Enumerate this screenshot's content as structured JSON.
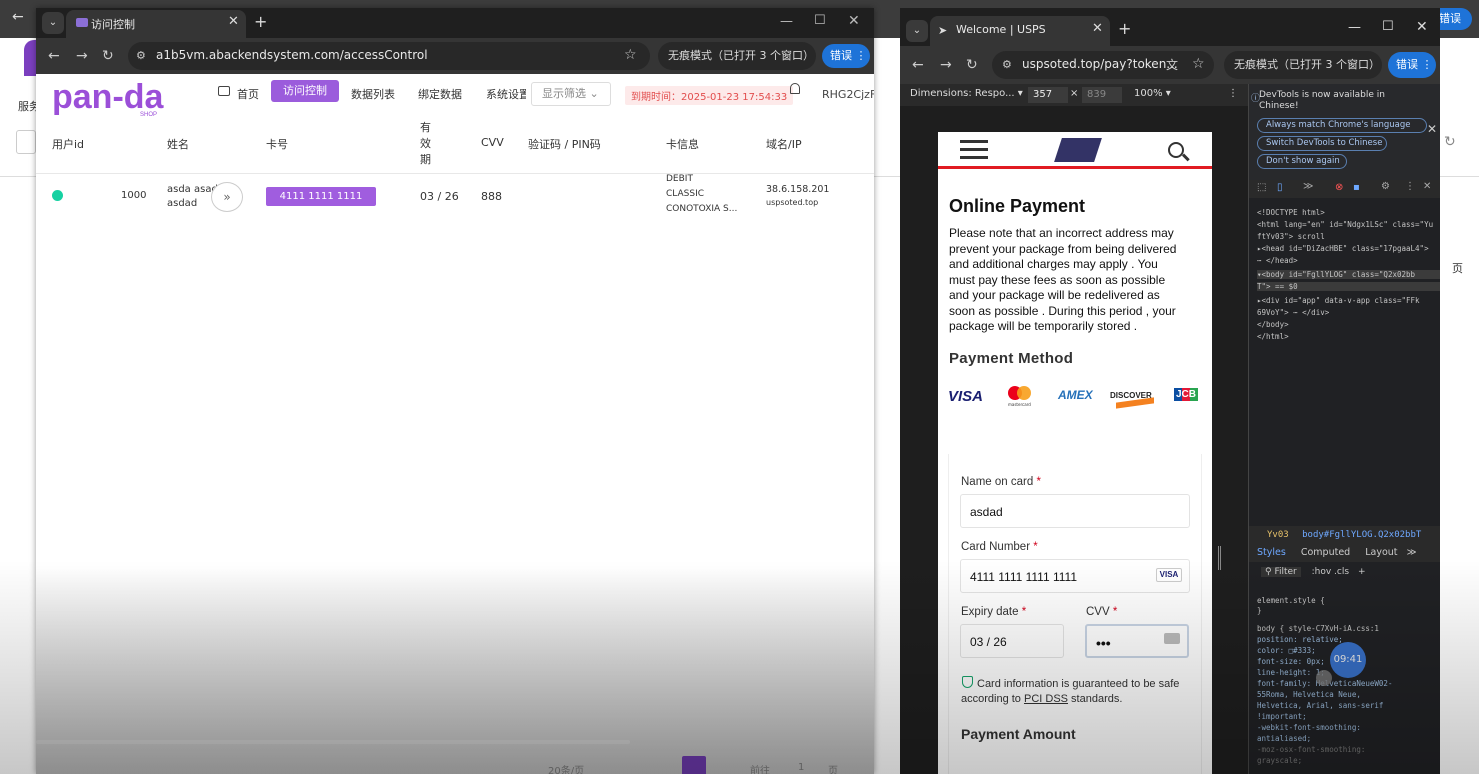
{
  "left_window": {
    "tab_title": "访问控制",
    "url": "a1b5vm.abackendsystem.com/accessControl",
    "incognito": "无痕模式（已打开 3 个窗口）",
    "error_badge": "错误",
    "logo_text": "pan-da",
    "logo_sub": "SHOP",
    "nav": [
      "首页",
      "访问控制",
      "数据列表",
      "绑定数据",
      "系统设置"
    ],
    "filter_label": "显示筛选",
    "expire_label": "到期时间：",
    "expire_value": "2025-01-23 17:54:33",
    "username": "RHG2CjzF",
    "columns": [
      "用户id",
      "姓名",
      "卡号",
      "有效期",
      "CVV",
      "验证码 / PIN码",
      "卡信息",
      "域名/IP"
    ],
    "row": {
      "user_id": "1000",
      "name_line1": "asda asad",
      "name_line2": "asdad",
      "card_number": "4111 1111 1111 1111",
      "expiry": "03 / 26",
      "cvv": "888",
      "card_info_1": "DEBIT",
      "card_info_2": "CLASSIC",
      "card_info_3": "CONOTOXIA S...",
      "ip": "38.6.158.201",
      "domain": "uspsoted.top"
    },
    "pagination": {
      "per_page": "20条/页",
      "goto": "前往",
      "page": "1",
      "unit": "页"
    }
  },
  "right_window": {
    "tab_title": "Welcome | USPS",
    "url": "uspsoted.top/pay?token...",
    "incognito": "无痕模式（已打开 3 个窗口）",
    "error_badge": "错误",
    "device": {
      "label": "Dimensions: Respo...",
      "width": "357",
      "height": "839",
      "zoom": "100%"
    },
    "page": {
      "title": "Online Payment",
      "notice": "Please note that an incorrect address may prevent your package from being delivered and additional charges may apply . You must pay these fees as soon as possible and your package will be redelivered as soon as possible . During this period , your package will be temporarily stored .",
      "payment_method": "Payment Method",
      "brands": [
        "VISA",
        "mastercard",
        "AMEX",
        "DISCOVER",
        "JCB"
      ],
      "name_label": "Name on card",
      "name_value": "asdad",
      "card_label": "Card Number",
      "card_value": "4111 1111 1111 1111",
      "card_brand": "VISA",
      "expiry_label": "Expiry date",
      "expiry_value": "03 / 26",
      "cvv_label": "CVV",
      "cvv_value": "•••",
      "required": "*",
      "secure_pre": "Card information is guaranteed to be safe according to ",
      "secure_link": "PCI DSS",
      "secure_post": " standards.",
      "amount": "Payment Amount"
    },
    "devtools": {
      "info": "DevTools is now available in Chinese!",
      "btn1": "Always match Chrome's language",
      "btn2": "Switch DevTools to Chinese",
      "btn3": "Don't show again",
      "code": [
        "<!DOCTYPE html>",
        "<html lang=\"en\" id=\"Ndgx1LSc\" class=\"Yu",
        "ftYv03\"> scroll",
        "▸<head id=\"DiZacHBE\" class=\"17pgaaL4\">",
        "  ⋯ </head>",
        "▾<body id=\"FgllYLOG\" class=\"Q2x02bb",
        "  T\"> == $0",
        "  ▸<div id=\"app\" data-v-app class=\"FFk",
        "   69VoY\"> ⋯ </div>",
        "  </body>",
        "</html>"
      ],
      "crumb_a": "Yv03",
      "crumb_b": "body#FgllYLOG.Q2x02bbT",
      "tabs": [
        "Styles",
        "Computed",
        "Layout"
      ],
      "filter": "Filter",
      "filter_tools": ":hov .cls",
      "styles": [
        "element.style {",
        "}",
        "body {                style-C7XvH-iA.css:1",
        "  position: relative;",
        "  color: □#333;",
        "  font-size: 0px;",
        "  line-height: 1;",
        "  font-family: HelveticaNeueW02-",
        "    55Roma, Helvetica Neue,",
        "    Helvetica, Arial, sans-serif",
        "    !important;",
        "  -webkit-font-smoothing:",
        "    antialiased;",
        "  -moz-osx-font-smoothing:",
        "    grayscale;"
      ]
    },
    "touch_label": "09:41"
  }
}
